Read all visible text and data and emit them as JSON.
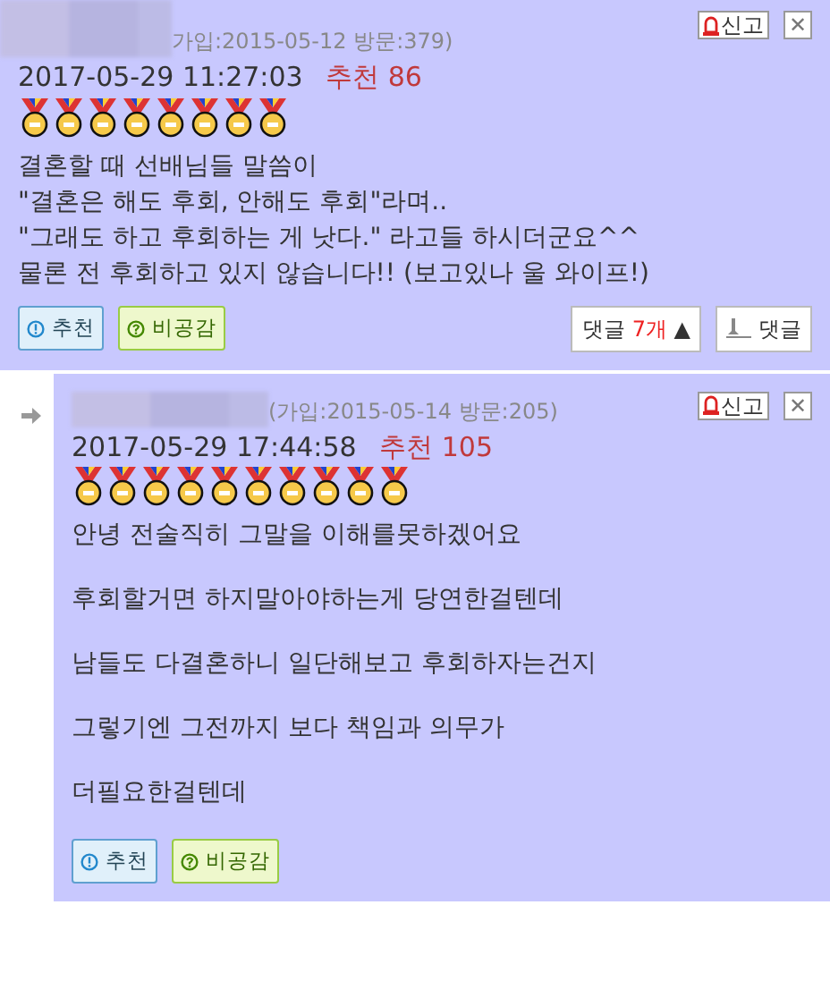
{
  "posts": [
    {
      "reply": false,
      "join_info": "가입:2015-05-12 방문:379)",
      "datetime": "2017-05-29 11:27:03",
      "recommend_label": "추천",
      "recommend_count": "86",
      "report": "신고",
      "close": "✕",
      "badges": [
        {
          "kind": "medal"
        },
        {
          "kind": "medal"
        },
        {
          "kind": "medal"
        },
        {
          "kind": "medal"
        },
        {
          "kind": "medal"
        },
        {
          "kind": "medal"
        },
        {
          "kind": "medal"
        },
        {
          "kind": "medal"
        }
      ],
      "paragraphs": [
        "결혼할 때 선배님들 말씀이\n\"결혼은 해도 후회, 안해도 후회\"라며..\n\"그래도 하고 후회하는 게 낫다.\" 라고들 하시더군요^^\n물론 전 후회하고 있지 않습니다!! (보고있나 울 와이프!)"
      ],
      "like": "추천",
      "dislike": "비공감",
      "comments_label": "댓글",
      "comments_count": "7개",
      "comments_caret": "▲",
      "reply_button": "댓글"
    },
    {
      "reply": true,
      "join_info": "(가입:2015-05-14 방문:205)",
      "datetime": "2017-05-29 17:44:58",
      "recommend_label": "추천",
      "recommend_count": "105",
      "report": "신고",
      "close": "✕",
      "badges": [
        {
          "kind": "medal"
        },
        {
          "kind": "medal"
        },
        {
          "kind": "medal"
        },
        {
          "kind": "medal"
        },
        {
          "kind": "medal"
        },
        {
          "kind": "medal"
        },
        {
          "kind": "medal"
        },
        {
          "kind": "medal"
        },
        {
          "kind": "medal"
        },
        {
          "kind": "medal"
        }
      ],
      "paragraphs": [
        "안녕 전술직히 그말을 이해를못하겠어요",
        "후회할거면 하지말아야하는게 당연한걸텐데",
        "남들도 다결혼하니 일단해보고 후회하자는건지",
        "그렇기엔 그전까지 보다 책임과 의무가",
        "더필요한걸텐데"
      ],
      "like": "추천",
      "dislike": "비공감"
    }
  ]
}
